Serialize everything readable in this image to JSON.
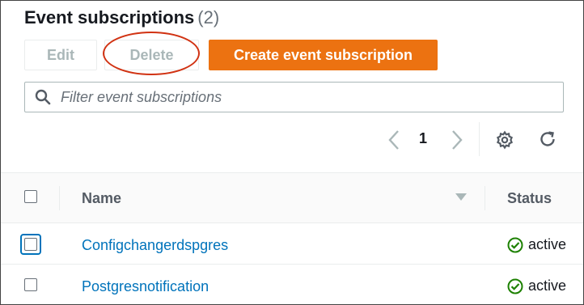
{
  "header": {
    "title": "Event subscriptions",
    "count": "(2)"
  },
  "toolbar": {
    "edit_label": "Edit",
    "delete_label": "Delete",
    "create_label": "Create event subscription"
  },
  "search": {
    "placeholder": "Filter event subscriptions",
    "value": ""
  },
  "pagination": {
    "current_page": "1"
  },
  "table": {
    "columns": [
      "Name",
      "Status"
    ],
    "rows": [
      {
        "name": "Configchangerdspgres",
        "status": "active"
      },
      {
        "name": "Postgresnotification",
        "status": "active"
      }
    ]
  },
  "colors": {
    "accent": "#ec7211",
    "link": "#0073bb",
    "success": "#1d8102",
    "highlight": "#d13212"
  },
  "icons": [
    "search-icon",
    "chevron-left-icon",
    "chevron-right-icon",
    "gear-icon",
    "refresh-icon",
    "sort-caret-icon",
    "check-circle-icon"
  ]
}
